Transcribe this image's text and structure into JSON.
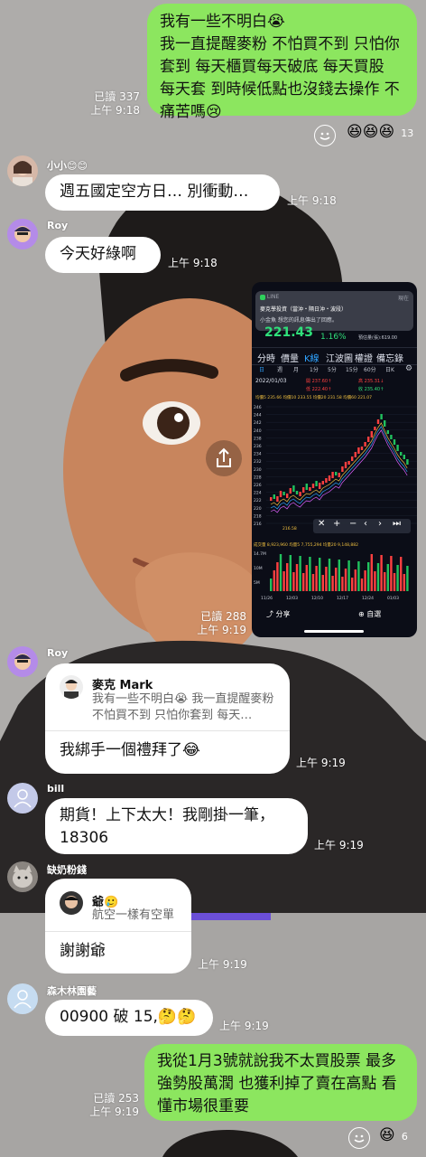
{
  "messages": {
    "m1": {
      "text": "我有一些不明白😭\n我一直提醒麥粉 不怕買不到 只怕你套到 每天櫃買每天破底 每天買股 每天套 到時候低點也沒錢去操作 不痛苦嗎😢",
      "read": "已讀 337",
      "time": "上午 9:18",
      "reaction_count": "13"
    },
    "m2": {
      "sender": "小小😊😊",
      "text": "週五國定空方日… 別衝動…",
      "time": "上午 9:18"
    },
    "m3": {
      "sender": "Roy",
      "text": "今天好綠啊",
      "time": "上午 9:18"
    },
    "m4": {
      "read": "已讀 288",
      "time": "上午 9:19"
    },
    "m5": {
      "sender": "Roy",
      "reply_name": "麥克 Mark",
      "reply_text": "我有一些不明白😭 我一直提醒麥粉 不怕買不到 只怕你套到 每天…",
      "text": "我綁手一個禮拜了😂",
      "time": "上午 9:19"
    },
    "m6": {
      "sender": "bill",
      "text": "期貨！上下太大！我剛掛一筆，18306",
      "time": "上午 9:19"
    },
    "m7": {
      "sender": "缺奶粉錢",
      "reply_name": "爺🥲",
      "reply_text": "航空一樣有空單",
      "text": "謝謝爺",
      "time": "上午 9:19"
    },
    "m8": {
      "sender": "森木林園藝",
      "text": "00900 破 15,🤔🤔",
      "time": "上午 9:19"
    },
    "m9": {
      "text": "我從1月3號就說我不太買股票 最多強勢股萬潤 也獲利掉了賣在高點 看懂市場很重要",
      "read": "已讀 253",
      "time": "上午 9:19",
      "reaction_count": "6"
    }
  },
  "screenshot": {
    "notif_app": "LINE",
    "notif_title": "麥克學投資（當沖・隔日沖・波段）",
    "notif_body": "小金魚 想您的訊息傳出了回應。",
    "notif_time": "現在",
    "price": "221.43",
    "change_pct": "1.16%",
    "volume_label": "預估量(張):619.00",
    "tabs": [
      "分時",
      "價量",
      "K線",
      "江波圖",
      "權證",
      "備忘錄"
    ],
    "periods": [
      "日",
      "週",
      "月",
      "1分",
      "5分",
      "15分",
      "60分",
      "日K"
    ],
    "date": "2022/01/03",
    "ohlc": [
      "開 237.60↑",
      "高 235.31↓",
      "低 222.40↑",
      "收 235.40↑"
    ],
    "ma_line": "均價5 235.66  均價10 233.55  均價20 231.58  均價60 221.07",
    "y_ticks": [
      "246",
      "244",
      "242",
      "240",
      "238",
      "236",
      "234",
      "232",
      "230",
      "228",
      "226",
      "224",
      "222",
      "220",
      "218",
      "216"
    ],
    "low_mark": "216.58",
    "vol_line": "成交量 8,923,960  均量5 7,755,294  均量20 9,148,882",
    "vol_axis": [
      "14.7M",
      "10M",
      "5M"
    ],
    "x_dates": [
      "11/26",
      "12/03",
      "12/10",
      "12/17",
      "12/24",
      "01/03"
    ],
    "share_label": "分享",
    "save_label": "自選"
  },
  "colors": {
    "green_bubble": "#8ce65f",
    "white_bubble": "#ffffff",
    "up": "#ff4040",
    "down": "#21c25e"
  }
}
